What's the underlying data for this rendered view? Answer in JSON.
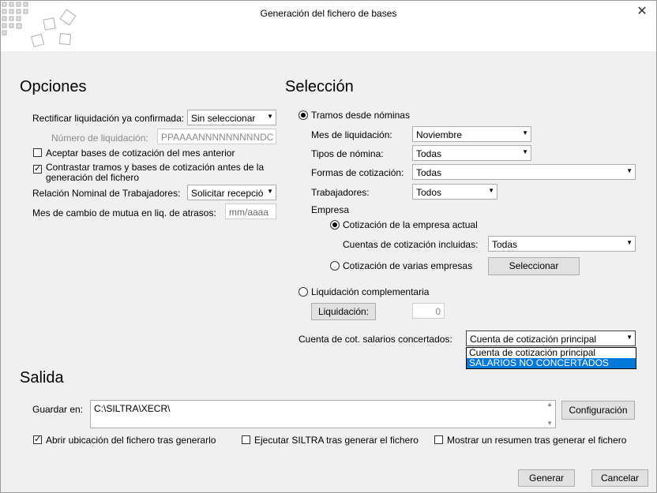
{
  "window": {
    "title": "Generación del fichero de bases",
    "close_icon": "close-icon"
  },
  "opciones": {
    "heading": "Opciones",
    "rectificar_label": "Rectificar liquidación ya confirmada:",
    "rectificar_value": "Sin seleccionar",
    "numero_label": "Número de liquidación:",
    "numero_placeholder": "PPAAAANNNNNNNNNDC",
    "aceptar_label": "Aceptar bases de cotización del mes anterior",
    "aceptar_checked": false,
    "contrastar_label_1": "Contrastar tramos y bases de cotización antes de la",
    "contrastar_label_2": "generación del fichero",
    "contrastar_checked": true,
    "relacion_label": "Relación Nominal de Trabajadores:",
    "relacion_value": "Solicitar recepció",
    "mes_cambio_label": "Mes de cambio de mutua en liq. de atrasos:",
    "mes_cambio_placeholder": "mm/aaaa"
  },
  "seleccion": {
    "heading": "Selección",
    "tramos_label": "Tramos desde nóminas",
    "tramos_selected": true,
    "mes_label": "Mes de liquidación:",
    "mes_value": "Noviembre",
    "tipos_label": "Tipos de nómina:",
    "tipos_value": "Todas",
    "formas_label": "Formas de cotización:",
    "formas_value": "Todas",
    "trabajadores_label": "Trabajadores:",
    "trabajadores_value": "Todos",
    "empresa_label": "Empresa",
    "empresa_actual_label": "Cotización de la empresa actual",
    "empresa_actual_selected": true,
    "cuentas_label": "Cuentas de cotización incluidas:",
    "cuentas_value": "Todas",
    "varias_label": "Cotización de varias empresas",
    "seleccionar_button": "Seleccionar",
    "complementaria_label": "Liquidación complementaria",
    "liquidacion_button": "Liquidación:",
    "liquidacion_value": "0",
    "cuenta_cot_label": "Cuenta de cot. salarios concertados:",
    "cuenta_cot_value": "Cuenta de cotización principal",
    "cuenta_cot_options": [
      "Cuenta de cotización principal",
      "SALARIOS NO CONCERTADOS"
    ]
  },
  "salida": {
    "heading": "Salida",
    "guardar_label": "Guardar en:",
    "guardar_value": "C:\\SILTRA\\XECR\\",
    "configuracion_button": "Configuración",
    "abrir_label": "Abrir ubicación del fichero tras generarlo",
    "abrir_checked": true,
    "ejecutar_label": "Ejecutar SILTRA tras generar el fichero",
    "ejecutar_checked": false,
    "mostrar_label": "Mostrar un resumen tras generar el fichero",
    "mostrar_checked": false
  },
  "footer": {
    "generar_button": "Generar",
    "cancelar_button": "Cancelar"
  },
  "colors": {
    "selection": "#0078d7",
    "window_bg": "#f0f0f0"
  }
}
